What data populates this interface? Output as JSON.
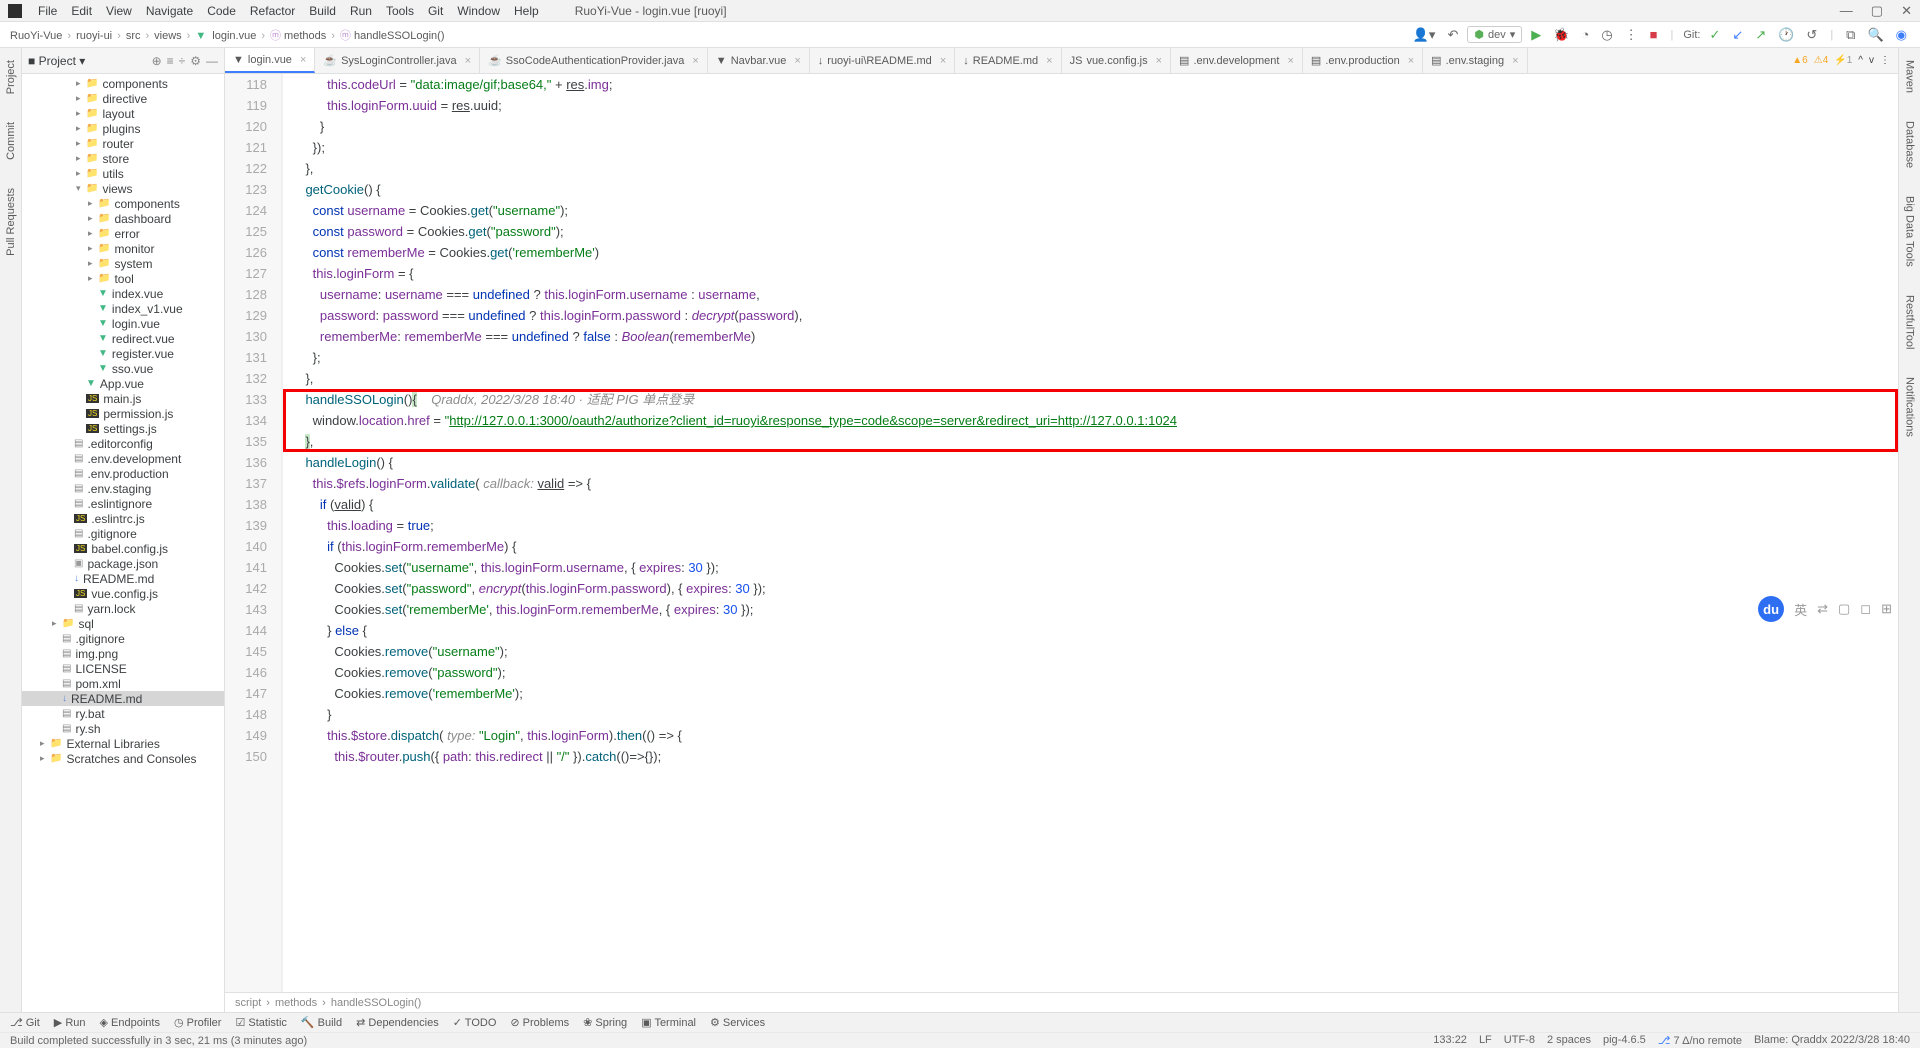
{
  "window_title": "RuoYi-Vue - login.vue [ruoyi]",
  "menubar": [
    "File",
    "Edit",
    "View",
    "Navigate",
    "Code",
    "Refactor",
    "Build",
    "Run",
    "Tools",
    "Git",
    "Window",
    "Help"
  ],
  "breadcrumbs": [
    "RuoYi-Vue",
    "ruoyi-ui",
    "src",
    "views",
    "login.vue",
    "methods",
    "handleSSOLogin()"
  ],
  "run_config": "dev",
  "git_label": "Git:",
  "left_tabs": [
    "Project",
    "Commit",
    "Pull Requests"
  ],
  "right_tabs": [
    "Maven",
    "Database",
    "Big Data Tools",
    "RestfulTool",
    "Notifications"
  ],
  "project_tree": [
    {
      "indent": 4,
      "arrow": ">",
      "icon": "folder",
      "label": "components"
    },
    {
      "indent": 4,
      "arrow": ">",
      "icon": "folder",
      "label": "directive"
    },
    {
      "indent": 4,
      "arrow": ">",
      "icon": "folder",
      "label": "layout"
    },
    {
      "indent": 4,
      "arrow": ">",
      "icon": "folder",
      "label": "plugins"
    },
    {
      "indent": 4,
      "arrow": ">",
      "icon": "folder",
      "label": "router"
    },
    {
      "indent": 4,
      "arrow": ">",
      "icon": "folder",
      "label": "store"
    },
    {
      "indent": 4,
      "arrow": ">",
      "icon": "folder",
      "label": "utils"
    },
    {
      "indent": 4,
      "arrow": "v",
      "icon": "folder",
      "label": "views"
    },
    {
      "indent": 5,
      "arrow": ">",
      "icon": "folder",
      "label": "components"
    },
    {
      "indent": 5,
      "arrow": ">",
      "icon": "folder",
      "label": "dashboard"
    },
    {
      "indent": 5,
      "arrow": ">",
      "icon": "folder",
      "label": "error"
    },
    {
      "indent": 5,
      "arrow": ">",
      "icon": "folder",
      "label": "monitor"
    },
    {
      "indent": 5,
      "arrow": ">",
      "icon": "folder",
      "label": "system"
    },
    {
      "indent": 5,
      "arrow": ">",
      "icon": "folder",
      "label": "tool"
    },
    {
      "indent": 5,
      "arrow": "",
      "icon": "vue",
      "label": "index.vue"
    },
    {
      "indent": 5,
      "arrow": "",
      "icon": "vue",
      "label": "index_v1.vue"
    },
    {
      "indent": 5,
      "arrow": "",
      "icon": "vue",
      "label": "login.vue"
    },
    {
      "indent": 5,
      "arrow": "",
      "icon": "vue",
      "label": "redirect.vue"
    },
    {
      "indent": 5,
      "arrow": "",
      "icon": "vue",
      "label": "register.vue"
    },
    {
      "indent": 5,
      "arrow": "",
      "icon": "vue",
      "label": "sso.vue"
    },
    {
      "indent": 4,
      "arrow": "",
      "icon": "vue",
      "label": "App.vue"
    },
    {
      "indent": 4,
      "arrow": "",
      "icon": "js",
      "label": "main.js"
    },
    {
      "indent": 4,
      "arrow": "",
      "icon": "js",
      "label": "permission.js"
    },
    {
      "indent": 4,
      "arrow": "",
      "icon": "js",
      "label": "settings.js"
    },
    {
      "indent": 3,
      "arrow": "",
      "icon": "config",
      "label": ".editorconfig"
    },
    {
      "indent": 3,
      "arrow": "",
      "icon": "config",
      "label": ".env.development"
    },
    {
      "indent": 3,
      "arrow": "",
      "icon": "config",
      "label": ".env.production"
    },
    {
      "indent": 3,
      "arrow": "",
      "icon": "config",
      "label": ".env.staging"
    },
    {
      "indent": 3,
      "arrow": "",
      "icon": "config",
      "label": ".eslintignore"
    },
    {
      "indent": 3,
      "arrow": "",
      "icon": "js",
      "label": ".eslintrc.js"
    },
    {
      "indent": 3,
      "arrow": "",
      "icon": "config",
      "label": ".gitignore"
    },
    {
      "indent": 3,
      "arrow": "",
      "icon": "js",
      "label": "babel.config.js"
    },
    {
      "indent": 3,
      "arrow": "",
      "icon": "json",
      "label": "package.json"
    },
    {
      "indent": 3,
      "arrow": "",
      "icon": "md",
      "label": "README.md"
    },
    {
      "indent": 3,
      "arrow": "",
      "icon": "js",
      "label": "vue.config.js"
    },
    {
      "indent": 3,
      "arrow": "",
      "icon": "config",
      "label": "yarn.lock"
    },
    {
      "indent": 2,
      "arrow": ">",
      "icon": "folder",
      "label": "sql"
    },
    {
      "indent": 2,
      "arrow": "",
      "icon": "config",
      "label": ".gitignore"
    },
    {
      "indent": 2,
      "arrow": "",
      "icon": "config",
      "label": "img.png"
    },
    {
      "indent": 2,
      "arrow": "",
      "icon": "config",
      "label": "LICENSE"
    },
    {
      "indent": 2,
      "arrow": "",
      "icon": "config",
      "label": "pom.xml"
    },
    {
      "indent": 2,
      "arrow": "",
      "icon": "md",
      "label": "README.md",
      "selected": true
    },
    {
      "indent": 2,
      "arrow": "",
      "icon": "config",
      "label": "ry.bat"
    },
    {
      "indent": 2,
      "arrow": "",
      "icon": "config",
      "label": "ry.sh"
    },
    {
      "indent": 1,
      "arrow": ">",
      "icon": "folder",
      "label": "External Libraries"
    },
    {
      "indent": 1,
      "arrow": ">",
      "icon": "folder",
      "label": "Scratches and Consoles"
    }
  ],
  "project_header": "Project",
  "tabs": [
    {
      "icon": "vue",
      "label": "login.vue",
      "active": true
    },
    {
      "icon": "java",
      "label": "SysLoginController.java"
    },
    {
      "icon": "java",
      "label": "SsoCodeAuthenticationProvider.java"
    },
    {
      "icon": "vue",
      "label": "Navbar.vue"
    },
    {
      "icon": "md",
      "label": "ruoyi-ui\\README.md"
    },
    {
      "icon": "md",
      "label": "README.md"
    },
    {
      "icon": "js",
      "label": "vue.config.js"
    },
    {
      "icon": "config",
      "label": ".env.development"
    },
    {
      "icon": "config",
      "label": ".env.production"
    },
    {
      "icon": "config",
      "label": ".env.staging"
    }
  ],
  "warnings": {
    "w": "6",
    "y": "4",
    "down": "1"
  },
  "lines": {
    "start": 118,
    "end": 150
  },
  "code_breadcrumb": [
    "script",
    "methods",
    "handleSSOLogin()"
  ],
  "bottom_tools": [
    "Git",
    "Run",
    "Endpoints",
    "Profiler",
    "Statistic",
    "Build",
    "Dependencies",
    "TODO",
    "Problems",
    "Spring",
    "Terminal",
    "Services"
  ],
  "status_left": "Build completed successfully in 3 sec, 21 ms (3 minutes ago)",
  "status_right": [
    "133:22",
    "LF",
    "UTF-8",
    "2 spaces",
    "pig-4.6.5",
    "7 Δ/no remote",
    "Blame: Qraddx 2022/3/28 18:40"
  ],
  "code_annotation": "Qraddx, 2022/3/28 18:40 · 适配 PIG 单点登录",
  "sso_url": "http://127.0.0.1:3000/oauth2/authorize?client_id=ruoyi&response_type=code&scope=server&redirect_uri=http://127.0.0.1:1024"
}
